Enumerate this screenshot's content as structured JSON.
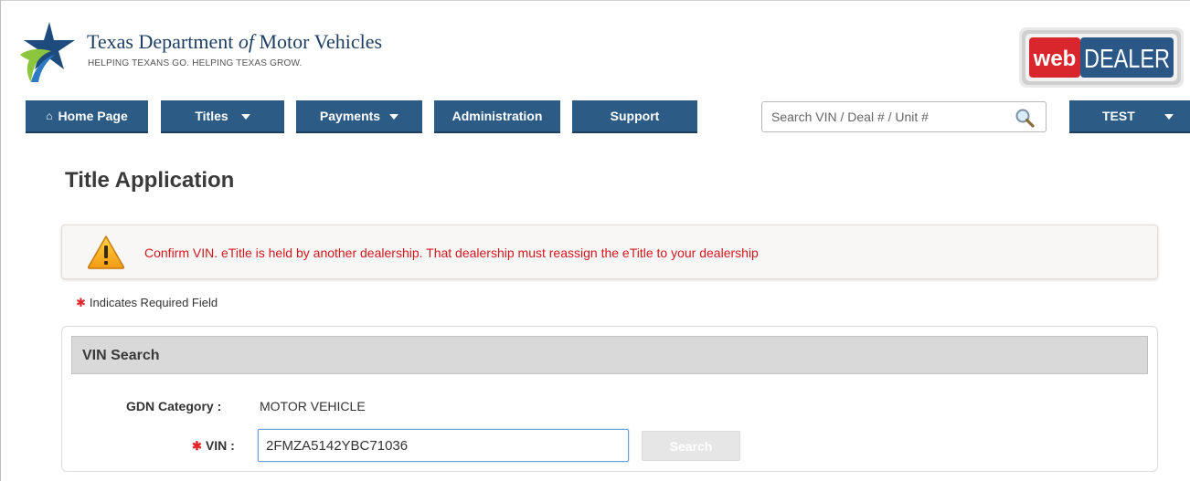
{
  "header": {
    "agency_name_pre": "Texas Department ",
    "agency_name_of": "of",
    "agency_name_post": " Motor Vehicles",
    "tagline": "HELPING TEXANS GO. HELPING TEXAS GROW.",
    "app_logo_web": "web",
    "app_logo_dealer": "DEALER"
  },
  "nav": {
    "home": "Home Page",
    "titles": "Titles",
    "payments": "Payments",
    "administration": "Administration",
    "support": "Support",
    "search_placeholder": "Search VIN / Deal # / Unit #",
    "user": "TEST"
  },
  "page": {
    "title": "Title Application",
    "alert": "Confirm VIN. eTitle is held by another dealership. That dealership must reassign the eTitle to your dealership",
    "required_note": "Indicates Required Field",
    "required_marker": "✱"
  },
  "vin_search": {
    "heading": "VIN Search",
    "gdn_label": "GDN Category :",
    "gdn_value": "MOTOR VEHICLE",
    "vin_label": "VIN :",
    "vin_value": "2FMZA5142YBC71036",
    "search_button": "Search"
  },
  "colors": {
    "nav_blue": "#2c5b85",
    "alert_red": "#d2181f",
    "required_red": "#e0262b",
    "logo_red": "#d9262c"
  },
  "icons": {
    "home": "home-icon",
    "search": "magnifier-icon",
    "alert": "warning-triangle-icon"
  }
}
